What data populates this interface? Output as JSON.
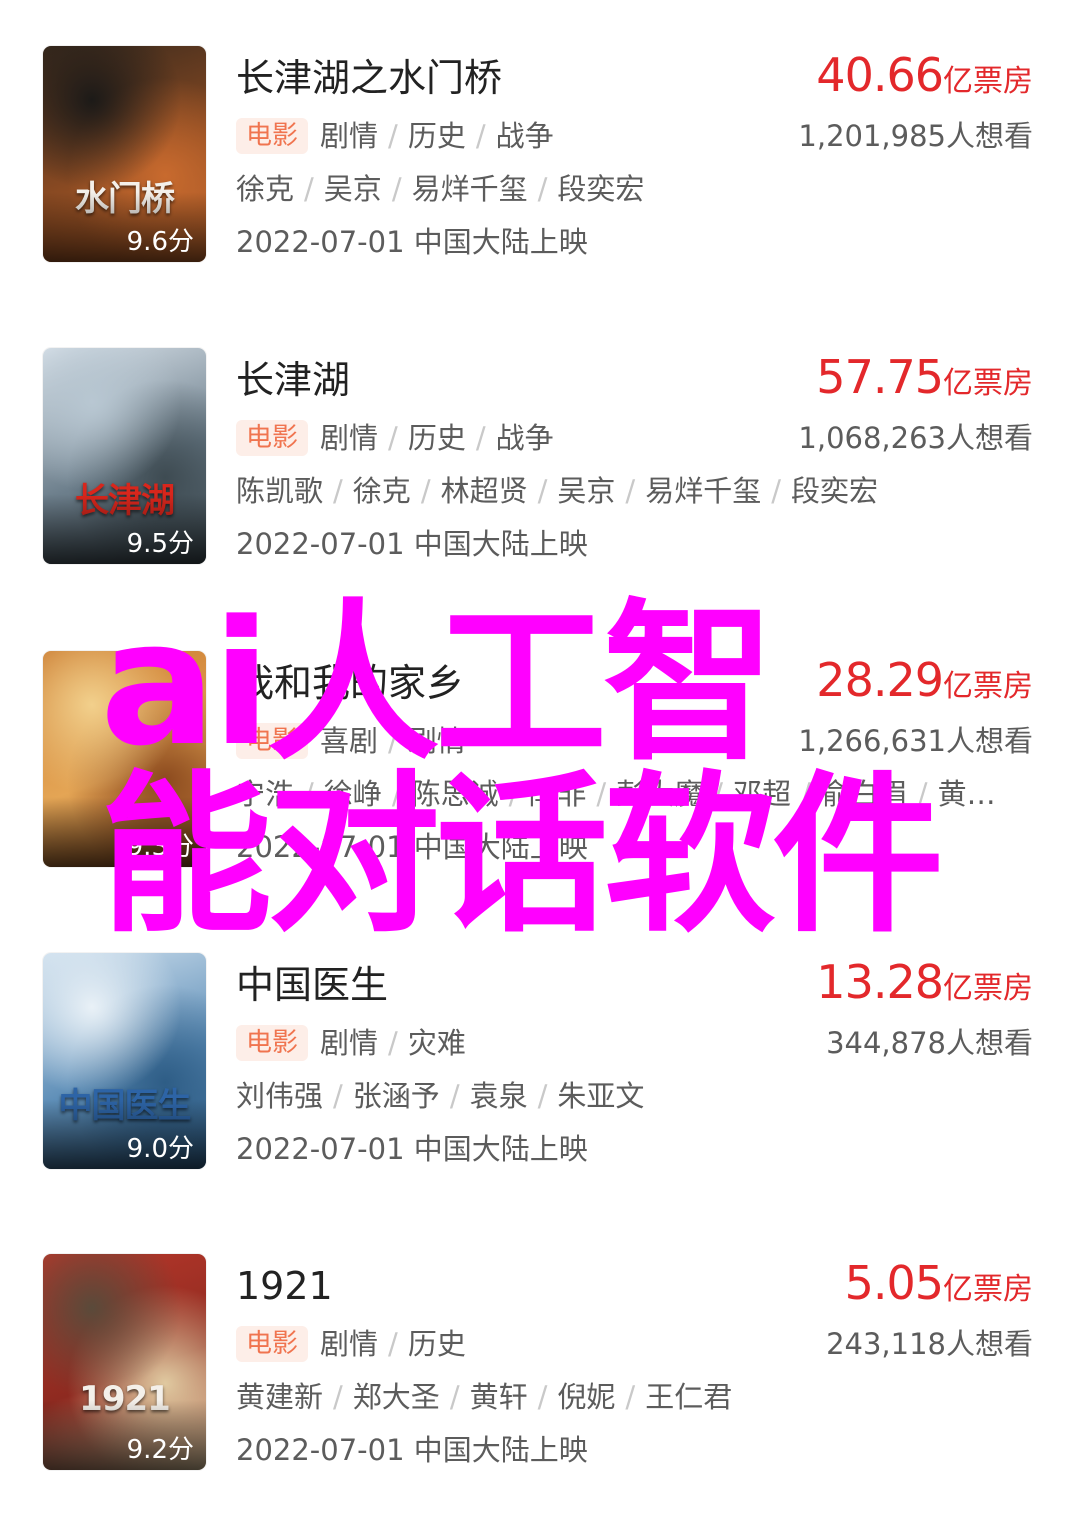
{
  "movies": [
    {
      "title": "长津湖之水门桥",
      "score": "9.6分",
      "box_office": "40.66",
      "box_unit": "亿票房",
      "wish": "1,201,985人想看",
      "tag": "电影",
      "genres": [
        "剧情",
        "历史",
        "战争"
      ],
      "cast": [
        "徐克",
        "吴京",
        "易烊千玺",
        "段奕宏"
      ],
      "release": "2022-07-01 中国大陆上映",
      "poster_text": "水门桥",
      "poster_colors": [
        "#3a2a1d",
        "#8a4a22",
        "#c86a2e",
        "#1c1a18"
      ]
    },
    {
      "title": "长津湖",
      "score": "9.5分",
      "box_office": "57.75",
      "box_unit": "亿票房",
      "wish": "1,068,263人想看",
      "tag": "电影",
      "genres": [
        "剧情",
        "历史",
        "战争"
      ],
      "cast": [
        "陈凯歌",
        "徐克",
        "林超贤",
        "吴京",
        "易烊千玺",
        "段奕宏"
      ],
      "release": "2022-07-01 中国大陆上映",
      "poster_text": "长津湖",
      "poster_colors": [
        "#d9e2ea",
        "#6d7f8c",
        "#3e4b52",
        "#b8c7d2"
      ]
    },
    {
      "title": "我和我的家乡",
      "score": "9.3分",
      "box_office": "28.29",
      "box_unit": "亿票房",
      "wish": "1,266,631人想看",
      "tag": "电影",
      "genres": [
        "喜剧",
        "剧情"
      ],
      "cast": [
        "宁浩",
        "徐峥",
        "陈思诚",
        "闫非",
        "彭大魔",
        "邓超",
        "俞白眉",
        "黄…"
      ],
      "release": "2022-07-01 中国大陆上映",
      "poster_text": "",
      "poster_colors": [
        "#c9792f",
        "#e4a555",
        "#8c4a1e",
        "#f2d08c"
      ]
    },
    {
      "title": "中国医生",
      "score": "9.0分",
      "box_office": "13.28",
      "box_unit": "亿票房",
      "wish": "344,878人想看",
      "tag": "电影",
      "genres": [
        "剧情",
        "灾难"
      ],
      "cast": [
        "刘伟强",
        "张涵予",
        "袁泉",
        "朱亚文"
      ],
      "release": "2022-07-01 中国大陆上映",
      "poster_text": "中国医生",
      "poster_colors": [
        "#cfe0ee",
        "#5f8fb8",
        "#2e5d86",
        "#e9f1f7"
      ]
    },
    {
      "title": "1921",
      "score": "9.2分",
      "box_office": "5.05",
      "box_unit": "亿票房",
      "wish": "243,118人想看",
      "tag": "电影",
      "genres": [
        "剧情",
        "历史"
      ],
      "cast": [
        "黄建新",
        "郑大圣",
        "黄轩",
        "倪妮",
        "王仁君"
      ],
      "release": "2022-07-01 中国大陆上映",
      "poster_text": "1921",
      "poster_colors": [
        "#b8382b",
        "#8e2a20",
        "#e0c9a0",
        "#5a4a3a"
      ]
    }
  ],
  "watermark": {
    "line1": "ai人工智",
    "line2": "能对话软件"
  }
}
